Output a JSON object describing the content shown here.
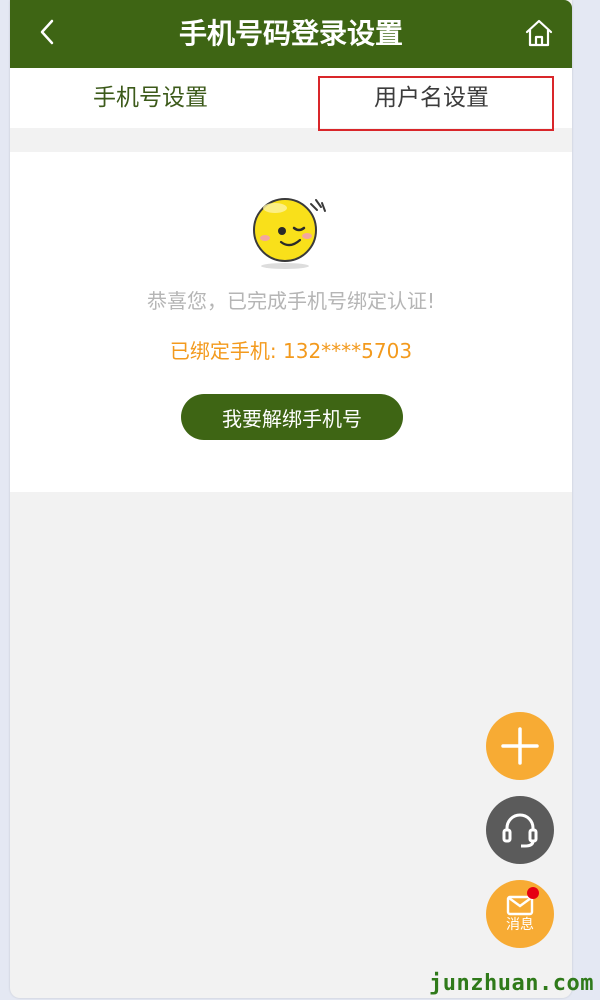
{
  "header": {
    "title": "手机号码登录设置",
    "back_icon": "chevron-left-icon",
    "home_icon": "home-icon"
  },
  "tabs": [
    {
      "label": "手机号设置"
    },
    {
      "label": "用户名设置"
    }
  ],
  "card": {
    "emoji_icon": "wink-emoji-icon",
    "message": "恭喜您，已完成手机号绑定认证!",
    "bound_text": "已绑定手机: 132****5703",
    "unbind_button": "我要解绑手机号"
  },
  "floating": {
    "plus_icon": "plus-icon",
    "service_icon": "headset-icon",
    "message_icon": "mail-icon",
    "message_label": "消息"
  },
  "watermark": "junzhuan.com",
  "colors": {
    "primary": "#3e6514",
    "accent": "#f7ab34",
    "bound_text": "#f39a1d",
    "highlight_border": "#d9262a",
    "service": "#5b5b5b"
  }
}
